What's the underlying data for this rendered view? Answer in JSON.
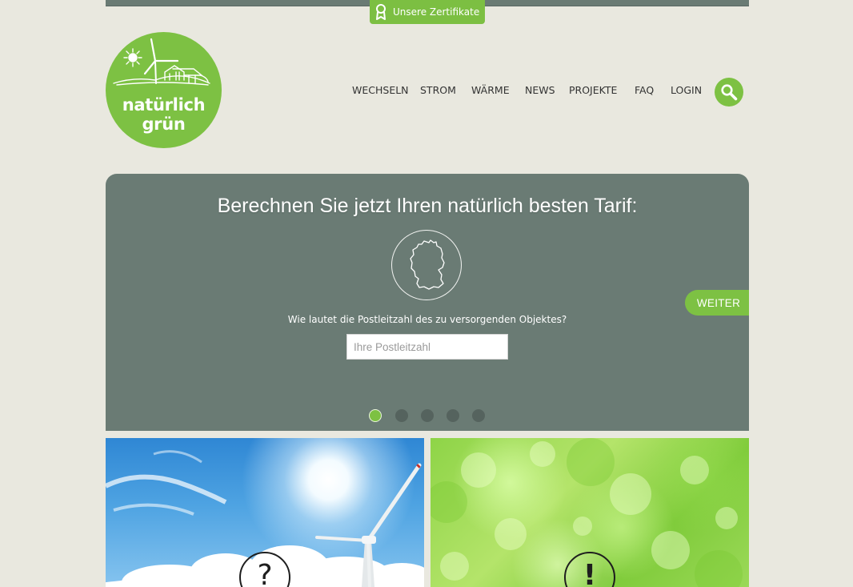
{
  "header": {
    "certificate_tab": {
      "label": "Unsere Zertifikate",
      "icon": "award-ribbon-icon"
    },
    "logo": {
      "line1": "natürlich",
      "line2": "grün"
    },
    "nav": [
      {
        "label": "WECHSELN"
      },
      {
        "label": "STROM"
      },
      {
        "label": "WÄRME"
      },
      {
        "label": "NEWS"
      },
      {
        "label": "PROJEKTE"
      },
      {
        "label": "FAQ"
      },
      {
        "label": "LOGIN"
      }
    ],
    "search_icon": "magnifier-icon"
  },
  "calculator": {
    "title": "Berechnen Sie jetzt Ihren natürlich besten Tarif:",
    "map_icon": "germany-map-icon",
    "question": "Wie lautet die Postleitzahl des zu versorgenden Objektes?",
    "zip_placeholder": "Ihre Postleitzahl",
    "zip_value": "",
    "next_label": "WEITER",
    "slides_total": 5,
    "active_slide": 1
  },
  "cards": [
    {
      "icon": "question-mark-icon",
      "glyph": "?"
    },
    {
      "icon": "exclamation-mark-icon",
      "glyph": "!"
    }
  ],
  "colors": {
    "brand_green": "#7dc143",
    "hero_gray": "#6a7b74",
    "page_bg": "#e9e8df"
  }
}
